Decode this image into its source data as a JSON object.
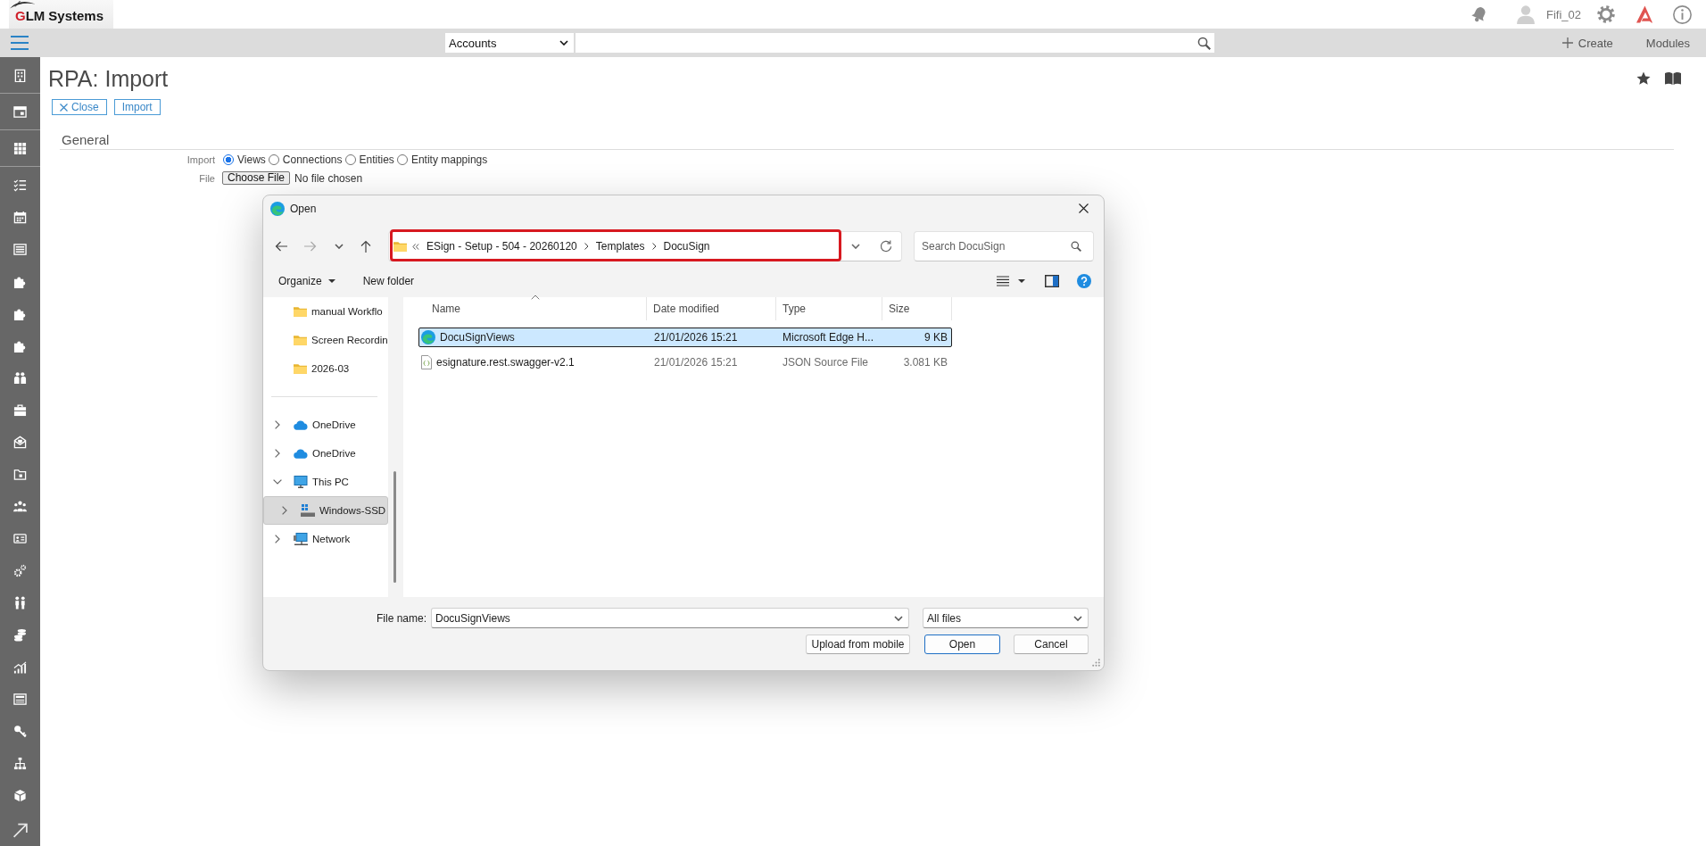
{
  "header": {
    "logo": {
      "mark": "GLM",
      "word": "Systems"
    },
    "user": "Fifi_02"
  },
  "toolbar": {
    "module": "Accounts",
    "create": "Create",
    "modules": "Modules"
  },
  "page": {
    "title": "RPA: Import",
    "actions": [
      {
        "label": "Close",
        "kind": "dismiss"
      },
      {
        "label": "Import",
        "kind": "plain"
      }
    ],
    "section": "General",
    "fields": [
      {
        "label": "Import",
        "kind": "radio",
        "options": [
          {
            "label": "Views",
            "selected": true
          },
          {
            "label": "Connections",
            "selected": false
          },
          {
            "label": "Entities",
            "selected": false
          },
          {
            "label": "Entity mappings",
            "selected": false
          }
        ]
      },
      {
        "label": "File",
        "kind": "file",
        "button": "Choose File",
        "status": "No file chosen"
      }
    ]
  },
  "dialog": {
    "title": "Open",
    "address": {
      "path": [
        "ESign - Setup - 504 - 20260120",
        "Templates",
        "DocuSign"
      ],
      "highlighted": true
    },
    "search": {
      "placeholder": "Search DocuSign"
    },
    "commands": [
      {
        "label": "Organize",
        "kind": "menu"
      },
      {
        "label": "New folder",
        "kind": "plain"
      }
    ],
    "nav_pane": {
      "pinned": [
        {
          "label": "manual Workflo",
          "selected": false
        },
        {
          "label": "Screen Recordin",
          "selected": false
        },
        {
          "label": "2026-03",
          "selected": false
        }
      ],
      "tree": [
        {
          "label": "OneDrive",
          "kind": "cloud",
          "expanded": false,
          "selected": false
        },
        {
          "label": "OneDrive",
          "kind": "cloud",
          "expanded": false,
          "selected": false
        },
        {
          "label": "This PC",
          "kind": "computer",
          "expanded": true,
          "selected": false,
          "children": [
            {
              "label": "Windows-SSD",
              "kind": "drive",
              "expanded": false,
              "selected": true
            }
          ]
        },
        {
          "label": "Network",
          "kind": "network",
          "expanded": false,
          "selected": false
        }
      ]
    },
    "columns": [
      {
        "label": "Name",
        "sorted": true
      },
      {
        "label": "Date modified",
        "sorted": false
      },
      {
        "label": "Type",
        "sorted": false
      },
      {
        "label": "Size",
        "sorted": false
      }
    ],
    "files": [
      {
        "name": "DocuSignViews",
        "kind": "edge",
        "date": "21/01/2026 15:21",
        "type": "Microsoft Edge H...",
        "size": "9 KB",
        "selected": true
      },
      {
        "name": "esignature.rest.swagger-v2.1",
        "kind": "json",
        "date": "21/01/2026 15:21",
        "type": "JSON Source File",
        "size": "3.081 KB",
        "selected": false
      }
    ],
    "file_name": {
      "label": "File name:",
      "value": "DocuSignViews"
    },
    "filter": "All files",
    "buttons": [
      {
        "label": "Upload from mobile",
        "default": false
      },
      {
        "label": "Open",
        "default": true
      },
      {
        "label": "Cancel",
        "default": false
      }
    ]
  }
}
